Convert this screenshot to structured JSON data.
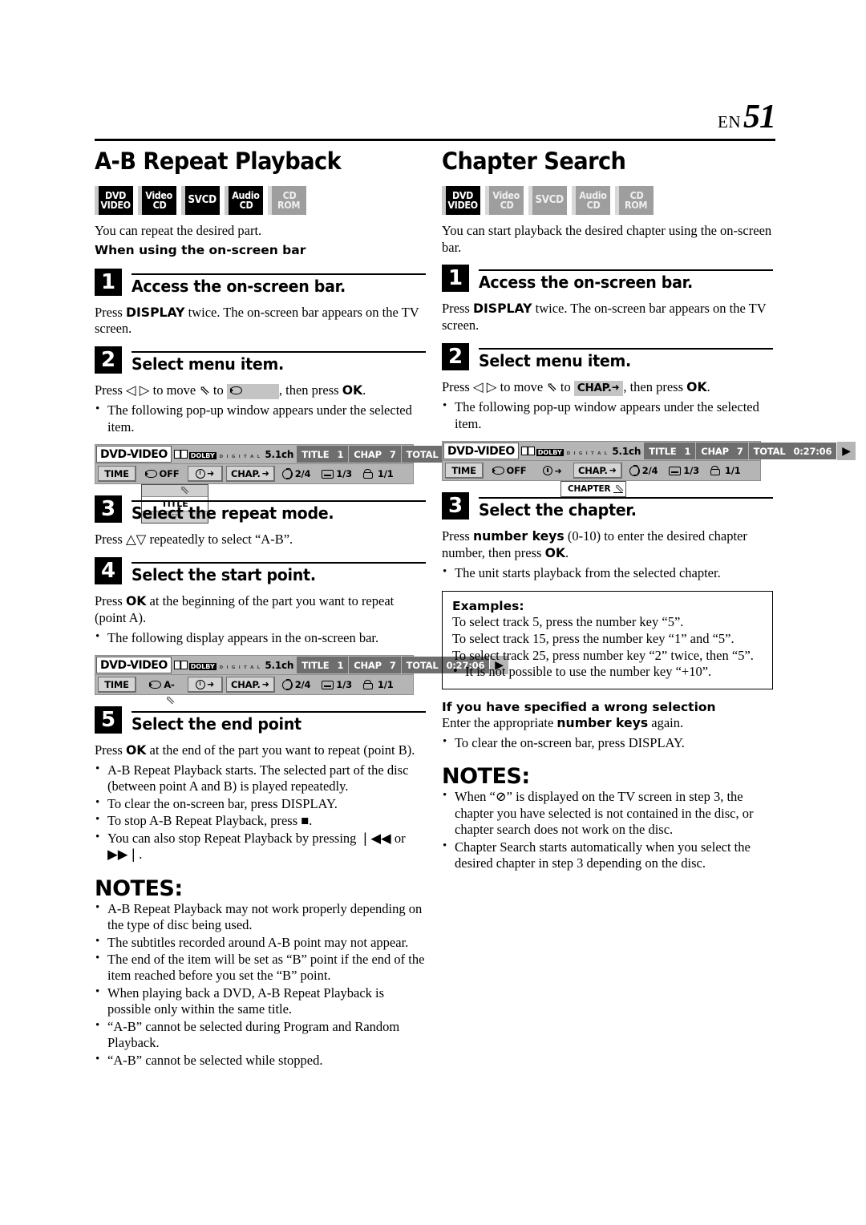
{
  "header": {
    "en_label": "EN",
    "page_number": "51"
  },
  "left": {
    "title": "A-B Repeat Playback",
    "badges": [
      {
        "name": "dvd-video",
        "line1": "DVD",
        "line2": "VIDEO",
        "active": true
      },
      {
        "name": "video-cd",
        "line1": "Video",
        "line2": "CD",
        "active": true
      },
      {
        "name": "svcd",
        "line1": "SVCD",
        "line2": "",
        "active": true
      },
      {
        "name": "audio-cd",
        "line1": "Audio",
        "line2": "CD",
        "active": true
      },
      {
        "name": "cd-rom",
        "line1": "CD",
        "line2": "ROM",
        "active": false
      }
    ],
    "intro": "You can repeat the desired part.",
    "sub_head": "When using the on-screen bar",
    "step1": {
      "num": "1",
      "title": "Access the on-screen bar.",
      "body_pre": "Press ",
      "body_bold": "DISPLAY",
      "body_post": " twice. The on-screen bar appears on the TV screen."
    },
    "step2": {
      "num": "2",
      "title": "Select menu item.",
      "line_a": "Press ",
      "arrows": "◁ ▷",
      "line_b": " to move ",
      "cursor": "⇖",
      "line_c": " to ",
      "chip_icon": "repeat-icon",
      "line_d": ", then press ",
      "ok": "OK",
      "line_e": ".",
      "bullet": "The following pop-up window appears under the selected item."
    },
    "step3": {
      "num": "3",
      "title": "Select the repeat mode.",
      "body_pre": "Press ",
      "arrows": "△▽",
      "body_post": " repeatedly to select “A-B”."
    },
    "step4": {
      "num": "4",
      "title": "Select the start point.",
      "body_pre": "Press ",
      "body_bold": "OK",
      "body_post": " at the beginning of the part you want to repeat (point A).",
      "bullet": "The following display appears in the on-screen bar."
    },
    "step5": {
      "num": "5",
      "title": "Select the end point",
      "body_pre": "Press ",
      "body_bold": "OK",
      "body_post": " at the end of the part you want to repeat (point B).",
      "bullets": [
        "A-B Repeat Playback starts. The selected part of the disc (between point A and B) is played repeatedly.",
        "To clear the on-screen bar, press DISPLAY.",
        "To stop A-B Repeat Playback, press ■.",
        "You can also stop Repeat Playback by pressing ❘◀◀ or ▶▶❘."
      ]
    },
    "notes_title": "NOTES:",
    "notes": [
      "A-B Repeat Playback may not work properly depending on the type of disc being used.",
      "The subtitles recorded around A-B point may not appear.",
      "The end of the item will be set as “B” point if the end of the item reached before you set the “B” point.",
      "When playing back a DVD, A-B Repeat Playback is possible only within the same title.",
      "“A-B” cannot be selected during Program and Random Playback.",
      "“A-B” cannot be selected while stopped."
    ]
  },
  "right": {
    "title": "Chapter Search",
    "badges": [
      {
        "name": "dvd-video",
        "line1": "DVD",
        "line2": "VIDEO",
        "active": true
      },
      {
        "name": "video-cd",
        "line1": "Video",
        "line2": "CD",
        "active": false
      },
      {
        "name": "svcd",
        "line1": "SVCD",
        "line2": "",
        "active": false
      },
      {
        "name": "audio-cd",
        "line1": "Audio",
        "line2": "CD",
        "active": false
      },
      {
        "name": "cd-rom",
        "line1": "CD",
        "line2": "ROM",
        "active": false
      }
    ],
    "intro": "You can start playback the desired chapter using the on-screen bar.",
    "step1": {
      "num": "1",
      "title": "Access the on-screen bar.",
      "body_pre": "Press ",
      "body_bold": "DISPLAY",
      "body_post": " twice. The on-screen bar appears on the TV screen."
    },
    "step2": {
      "num": "2",
      "title": "Select menu item.",
      "line_a": "Press ",
      "arrows": "◁ ▷",
      "line_b": " to move ",
      "cursor": "⇖",
      "line_c": " to ",
      "chip_label": "CHAP.",
      "line_d": ", then press ",
      "ok": "OK",
      "line_e": ".",
      "bullet": "The following pop-up window appears under the selected item."
    },
    "step3": {
      "num": "3",
      "title": "Select the chapter.",
      "body_pre": "Press ",
      "body_bold": "number keys",
      "body_mid": " (0-10) to enter the desired chapter number, then press ",
      "body_bold2": "OK",
      "body_post": ".",
      "bullet": "The unit starts playback from the selected chapter."
    },
    "examples": {
      "head": "Examples:",
      "lines": [
        "To select track 5, press the number key “5”.",
        "To select track 15, press the number key “1” and “5”.",
        "To select track 25, press number key “2” twice, then “5”."
      ],
      "bullet": "It is not possible to use the number key “+10”."
    },
    "wrong": {
      "head": "If you have specified a wrong selection",
      "body_pre": "Enter the appropriate ",
      "body_bold": "number keys",
      "body_post": " again.",
      "bullet": "To clear the on-screen bar, press DISPLAY."
    },
    "notes_title": "NOTES:",
    "notes": [
      "When “⊘” is displayed on the TV screen in step 3, the chapter you have selected is not contained in the disc, or chapter search does not work on the disc.",
      "Chapter Search starts automatically when you select the desired chapter in step 3 depending on the disc."
    ]
  },
  "osb": {
    "dvd_video_label": "DVD-VIDEO",
    "dolby_word": "DOLBY",
    "dolby_sub": "D I G I T A L",
    "channels": "5.1ch",
    "title_label": "TITLE",
    "title_value": "1",
    "chap_label": "CHAP",
    "chap_value": "7",
    "total_label": "TOTAL",
    "total_value": "0:27:06",
    "play_glyph": "▶",
    "btn_time": "TIME",
    "btn_repeat_off": "OFF",
    "btn_repeat_a": "A-",
    "btn_chap": "CHAP.",
    "btn_audio": "2/4",
    "btn_subtitle": "1/3",
    "btn_angle": "1/1",
    "popup_title_item": "TITLE",
    "popup_chapter_label": "CHAPTER",
    "cursor_glyph": "⇖"
  }
}
